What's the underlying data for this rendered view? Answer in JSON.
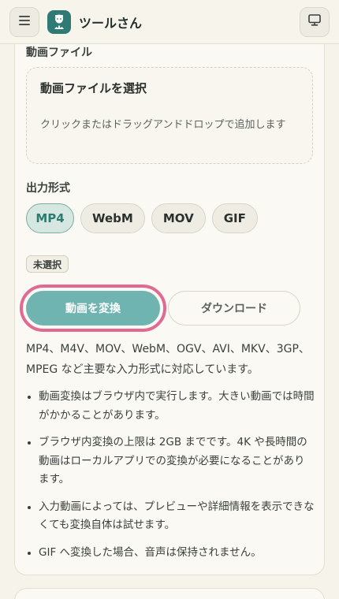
{
  "header": {
    "title": "ツールさん",
    "menu_icon": "hamburger-menu-icon",
    "logo_icon": "mascot-logo-icon",
    "monitor_icon": "monitor-icon"
  },
  "file_section": {
    "label": "動画ファイル",
    "dropzone_title": "動画ファイルを選択",
    "dropzone_hint": "クリックまたはドラッグアンドドロップで追加します"
  },
  "format_section": {
    "label": "出力形式",
    "options": [
      "MP4",
      "WebM",
      "MOV",
      "GIF"
    ],
    "selected": "MP4"
  },
  "status_badge": "未選択",
  "buttons": {
    "convert": "動画を変換",
    "download": "ダウンロード"
  },
  "description": "MP4、M4V、MOV、WebM、OGV、AVI、MKV、3GP、MPEG など主要な入力形式に対応しています。",
  "notes": [
    "動画変換はブラウザ内で実行します。大きい動画では時間がかかることがあります。",
    "ブラウザ内変換の上限は 2GB までです。4K や長時間の動画はローカルアプリでの変換が必要になることがあります。",
    "入力動画によっては、プレビューや詳細情報を表示できなくても変換自体は試せます。",
    "GIF へ変換した場合、音声は保持されません。"
  ],
  "colors": {
    "accent": "#6fb4b1",
    "accent_text": "#2e7b72",
    "highlight_ring": "#e06a93",
    "background": "#f6f3ea"
  }
}
